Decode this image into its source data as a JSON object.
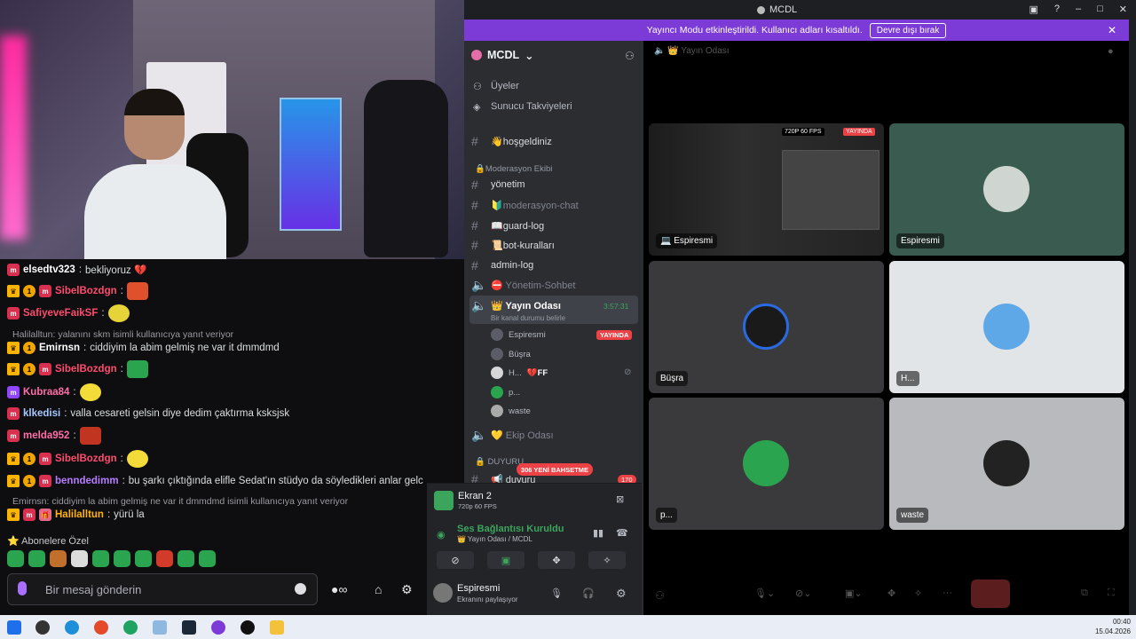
{
  "window": {
    "title": "MCDL"
  },
  "banner": {
    "text": "Yayıncı Modu etkinleştirildi. Kullanıcı adları kısaltıldı.",
    "button": "Devre dışı bırak"
  },
  "server": {
    "name": "MCDL",
    "members": "Üyeler",
    "boosts": "Sunucu Takviyeleri"
  },
  "channels": [
    {
      "label": "👋hoşgeldiniz"
    },
    {
      "label": "yönetim",
      "cat": "🔒Moderasyon Ekibi"
    },
    {
      "label": "🔰moderasyon-chat"
    },
    {
      "label": "📖guard-log"
    },
    {
      "label": "📜bot-kuralları"
    },
    {
      "label": "admin-log"
    },
    {
      "label": "⛔ Yönetim-Sohbet"
    },
    {
      "label": "👑 Yayın Odası",
      "sub": "Bir kanal durumu belirle",
      "timer": "3:57:31"
    },
    {
      "label": "💛 Ekip Odası"
    },
    {
      "label": "📢 duyuru"
    }
  ],
  "category_moderation": "🔒Moderasyon Ekibi",
  "category_announce": "🔒 DUYURU",
  "new_badge": "306 YENİ BAHSETME",
  "voice_users": [
    {
      "name": "Espiresmi",
      "badge": "YAYINDA"
    },
    {
      "name": "Büşra"
    },
    {
      "name": "H...",
      "extra": "💔FF"
    },
    {
      "name": "p..."
    },
    {
      "name": "waste"
    }
  ],
  "unread_count": "170",
  "screen": {
    "title": "Ekran 2",
    "quality": "720p 60 FPS"
  },
  "connection": {
    "status": "Ses Bağlantısı Kuruldu",
    "channel": "👑 Yayın Odası / MCDL"
  },
  "me": {
    "name": "Espiresmi",
    "status": "Ekranını paylaşıyor"
  },
  "header_channel": "👑 Yayın Odası",
  "tiles": [
    {
      "label": "💻 Espiresmi",
      "badge": "YAYINDA",
      "fps": "720P 60 FPS"
    },
    {
      "label": "Espiresmi"
    },
    {
      "label": "Büşra"
    },
    {
      "label": "H..."
    },
    {
      "label": "p..."
    },
    {
      "label": "waste"
    }
  ],
  "chat": [
    {
      "user": "elsedtv323",
      "text": "bekliyoruz 💔",
      "color": "#ffffff"
    },
    {
      "user": "SibelBozdgn",
      "text": "",
      "color": "#ff4b6e"
    },
    {
      "user": "SafiyeveFaikSF",
      "text": "",
      "color": "#ff4b6e"
    },
    {
      "reply": "Halilalltun: yalanını skm isimli kullanıcıya yanıt veriyor"
    },
    {
      "user": "Emirnsn",
      "text": "ciddiyim la abim gelmiş ne var it dmmdmd",
      "color": "#ffffff"
    },
    {
      "user": "SibelBozdgn",
      "text": "",
      "color": "#ff4b6e"
    },
    {
      "user": "Kubraa84",
      "text": "",
      "color": "#ff6ea8"
    },
    {
      "user": "klkedisi",
      "text": "valla cesareti gelsin diye dedim çaktırma ksksjsk",
      "color": "#a7c8ff"
    },
    {
      "user": "melda952",
      "text": "",
      "color": "#ff6ea8"
    },
    {
      "user": "SibelBozdgn",
      "text": "",
      "color": "#ff4b6e"
    },
    {
      "user": "benndedimm",
      "text": "bu şarkı çıktığında elifle Sedat'ın stüdyo da söyledikleri anlar gelc",
      "color": "#b67cff"
    },
    {
      "reply": "Emirnsn: ciddiyim la abim gelmiş ne var it dmmdmd isimli kullanıcıya yanıt veriyor"
    },
    {
      "user": "Halilalltun",
      "text": "yürü la",
      "color": "#ffb400"
    }
  ],
  "subs_label": "Abonelere Özel",
  "chat_input": {
    "placeholder": "Bir mesaj gönderin"
  },
  "clock": {
    "time": "00:40",
    "date": "15.04.2026"
  }
}
